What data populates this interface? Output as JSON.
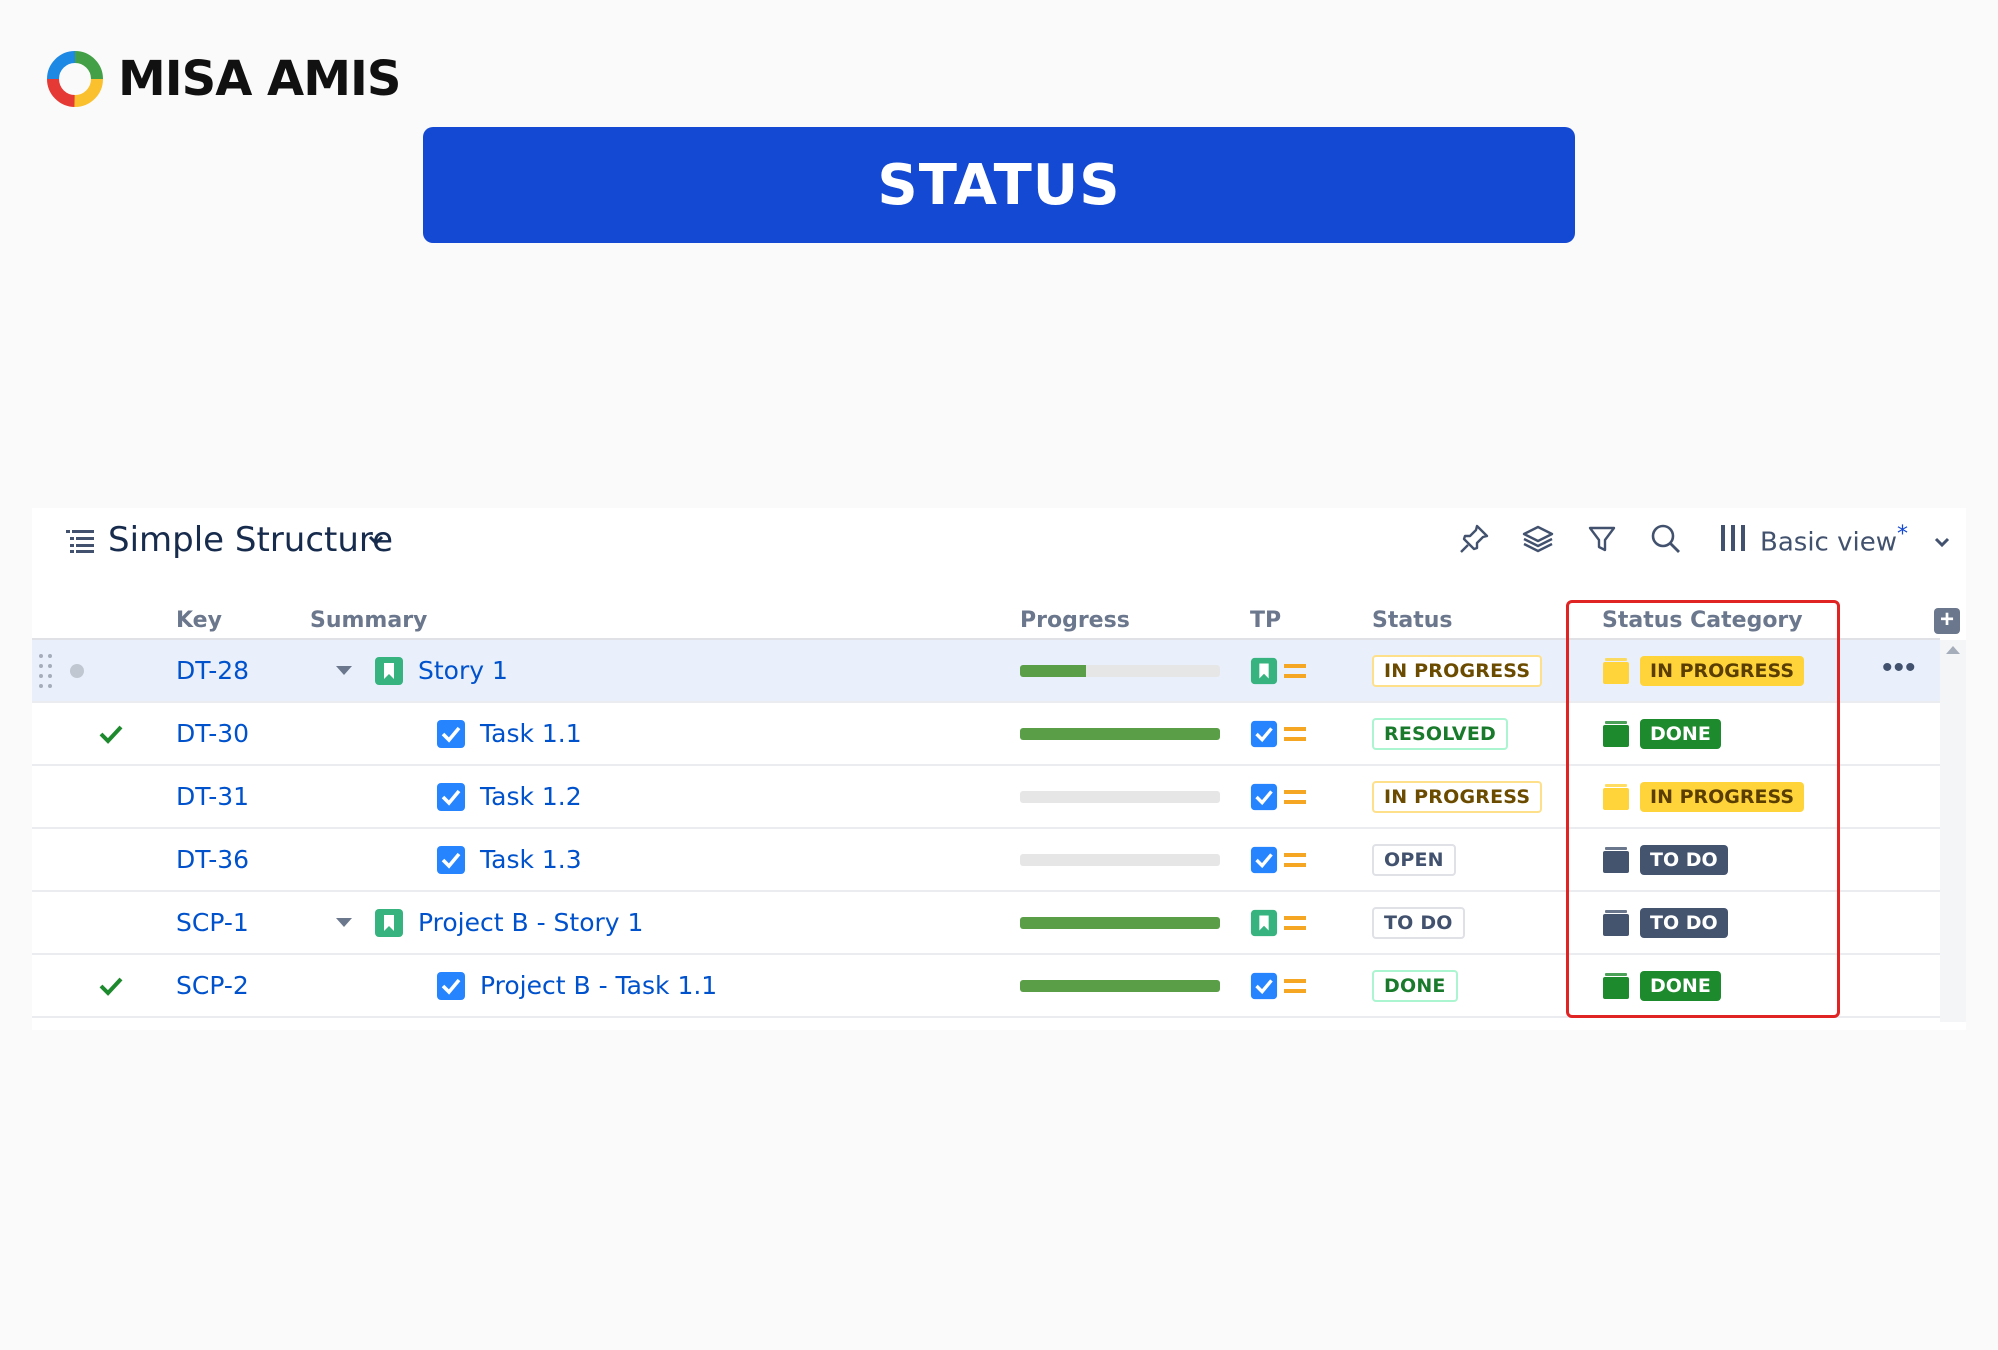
{
  "brand": {
    "name": "MISA AMIS"
  },
  "banner": {
    "title": "STATUS"
  },
  "structure": {
    "title": "Simple Structure",
    "view_label": "Basic view",
    "view_modified_marker": "*"
  },
  "columns": {
    "key": "Key",
    "summary": "Summary",
    "progress": "Progress",
    "tp": "TP",
    "status": "Status",
    "status_category": "Status Category"
  },
  "rows": [
    {
      "key": "DT-28",
      "summary": "Story 1",
      "type": "story",
      "indent": 0,
      "expandable": true,
      "resolved_check": false,
      "progress": 0.33,
      "status": "IN PROGRESS",
      "status_style": "inprogress",
      "category": "IN PROGRESS",
      "category_style": "inprogress",
      "selected": true
    },
    {
      "key": "DT-30",
      "summary": "Task 1.1",
      "type": "task",
      "indent": 1,
      "expandable": false,
      "resolved_check": true,
      "progress": 1.0,
      "status": "RESOLVED",
      "status_style": "green",
      "category": "DONE",
      "category_style": "done",
      "selected": false
    },
    {
      "key": "DT-31",
      "summary": "Task 1.2",
      "type": "task",
      "indent": 1,
      "expandable": false,
      "resolved_check": false,
      "progress": 0,
      "status": "IN PROGRESS",
      "status_style": "inprogress",
      "category": "IN PROGRESS",
      "category_style": "inprogress",
      "selected": false
    },
    {
      "key": "DT-36",
      "summary": "Task 1.3",
      "type": "task",
      "indent": 1,
      "expandable": false,
      "resolved_check": false,
      "progress": 0,
      "status": "OPEN",
      "status_style": "gray",
      "category": "TO DO",
      "category_style": "todo",
      "selected": false
    },
    {
      "key": "SCP-1",
      "summary": "Project B - Story 1",
      "type": "story",
      "indent": 0,
      "expandable": true,
      "resolved_check": false,
      "progress": 1.0,
      "status": "TO DO",
      "status_style": "gray",
      "category": "TO DO",
      "category_style": "todo",
      "selected": false
    },
    {
      "key": "SCP-2",
      "summary": "Project B - Task 1.1",
      "type": "task",
      "indent": 1,
      "expandable": false,
      "resolved_check": true,
      "progress": 1.0,
      "status": "DONE",
      "status_style": "green",
      "category": "DONE",
      "category_style": "done",
      "selected": false
    }
  ],
  "colors": {
    "banner": "#1449d4",
    "link": "#0052cc",
    "progress": "#5a9e47",
    "category_inprogress_bg": "#ffd43b",
    "category_inprogress_fg": "#5a3e00",
    "category_done_bg": "#1e8a2e",
    "category_todo_bg": "#44546f",
    "highlight_border": "#e02424",
    "story_icon": "#36b37e",
    "task_icon": "#2684ff"
  },
  "icons": [
    "pin-icon",
    "layers-icon",
    "filter-icon",
    "search-icon",
    "columns-icon",
    "chevron-down-icon",
    "more-icon",
    "add-column-icon",
    "drag-handle-icon"
  ]
}
